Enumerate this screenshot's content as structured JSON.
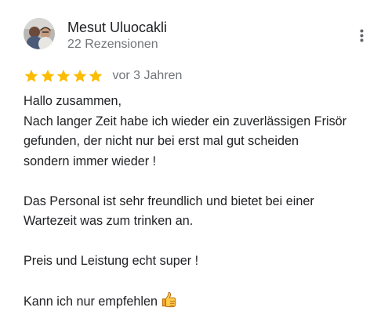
{
  "review": {
    "author_name": "Mesut Uluocakli",
    "author_meta": "22 Rezensionen",
    "rating": 5,
    "rating_max": 5,
    "time_ago": "vor 3 Jahren",
    "lines": [
      "Hallo zusammen,",
      "Nach langer Zeit habe ich wieder ein zuverlässigen Frisör",
      "gefunden, der nicht nur bei erst mal gut scheiden",
      "sondern immer wieder !",
      "",
      "Das Personal ist sehr freundlich und bietet bei einer",
      "Wartezeit was zum trinken an.",
      "",
      "Preis und Leistung echt super !",
      "",
      "Kann ich nur empfehlen"
    ],
    "emoji": "thumbs-up-icon"
  },
  "colors": {
    "star": "#fbbc04",
    "text": "#202124",
    "secondary": "#70757a"
  }
}
